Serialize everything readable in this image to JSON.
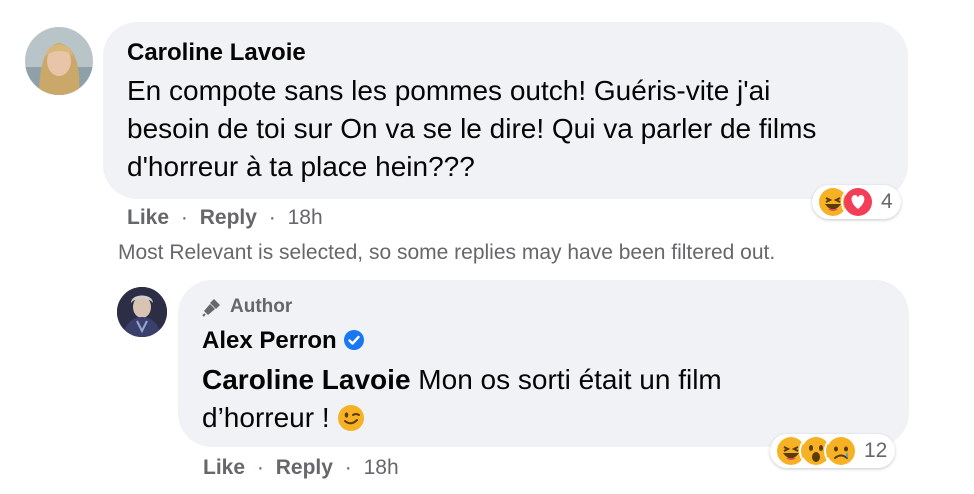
{
  "comment": {
    "author": "Caroline Lavoie",
    "text_lines": [
      "En compote sans les pommes outch! Guéris-vite j'ai",
      "besoin de toi sur On va se le dire! Qui va parler de films",
      "d'horreur à ta place hein???"
    ],
    "like_label": "Like",
    "reply_label": "Reply",
    "separator": "·",
    "time": "18h",
    "reaction_count": "4",
    "reaction_icons": [
      "laugh-icon",
      "love-icon"
    ]
  },
  "filter_notice": "Most Relevant is selected, so some replies may have been filtered out.",
  "reply": {
    "badge": "Author",
    "author": "Alex Perron",
    "mention": "Caroline Lavoie",
    "text_line1": " Mon os sorti était un film",
    "text_line2": "d’horreur ! ",
    "emoji": "wink-emoji",
    "like_label": "Like",
    "reply_label": "Reply",
    "separator": "·",
    "time": "18h",
    "reaction_count": "12",
    "reaction_icons": [
      "laugh-icon",
      "wow-icon",
      "sad-icon"
    ]
  },
  "colors": {
    "bubble": "#f0f2f5",
    "secondary_text": "#65676b",
    "verified": "#1877f2",
    "love": "#f33e58",
    "emoji_yellow": "#f7b125"
  }
}
